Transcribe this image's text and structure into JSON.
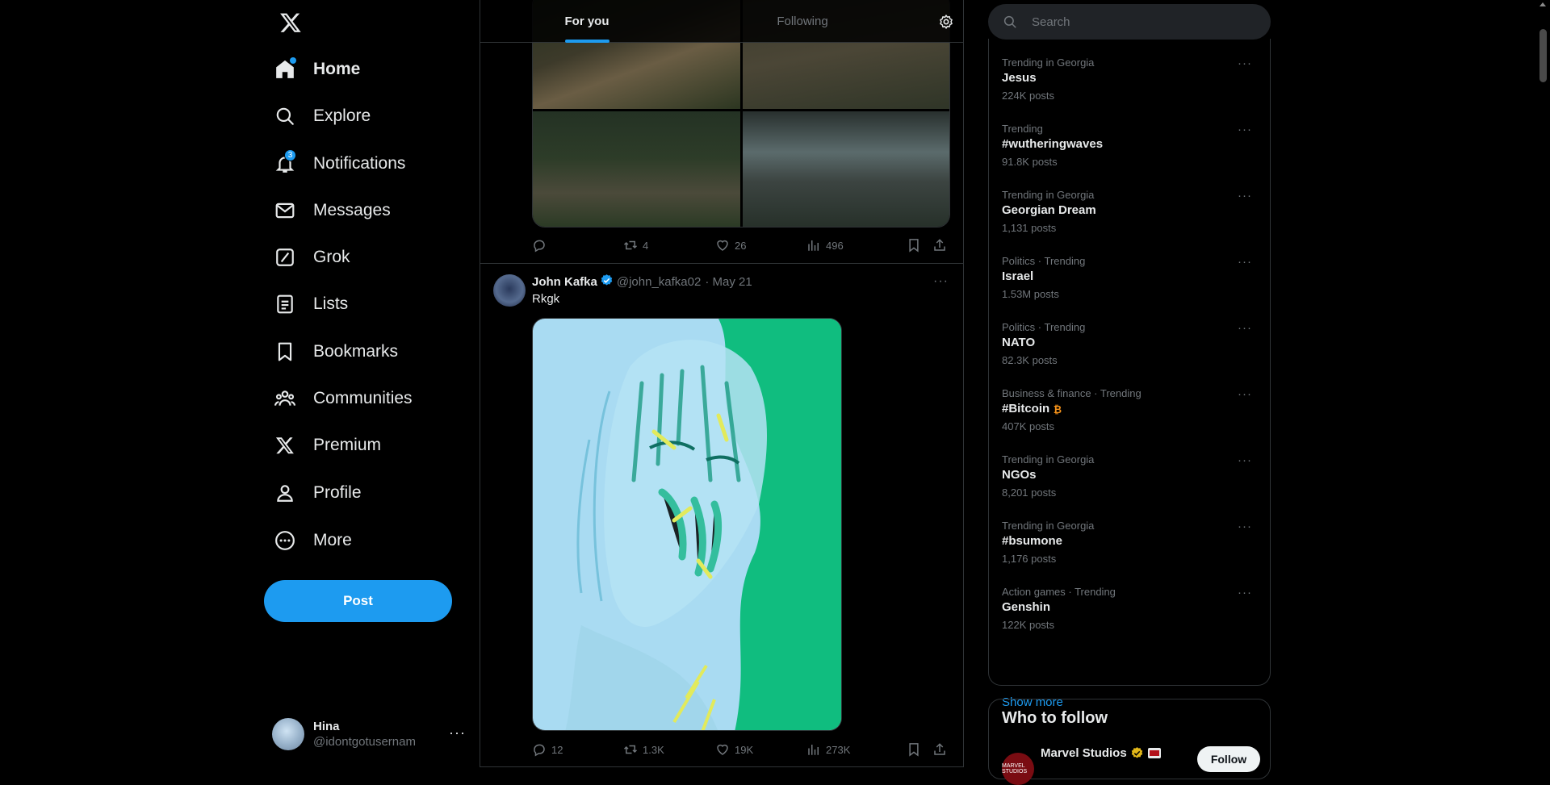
{
  "sidebar": {
    "items": [
      {
        "label": "Home",
        "icon": "home-icon"
      },
      {
        "label": "Explore",
        "icon": "search-icon"
      },
      {
        "label": "Notifications",
        "icon": "bell-icon",
        "badge": "3"
      },
      {
        "label": "Messages",
        "icon": "mail-icon"
      },
      {
        "label": "Grok",
        "icon": "grok-icon"
      },
      {
        "label": "Lists",
        "icon": "list-icon"
      },
      {
        "label": "Bookmarks",
        "icon": "bookmark-icon"
      },
      {
        "label": "Communities",
        "icon": "communities-icon"
      },
      {
        "label": "Premium",
        "icon": "x-logo-icon"
      },
      {
        "label": "Profile",
        "icon": "person-icon"
      },
      {
        "label": "More",
        "icon": "more-circle-icon"
      }
    ],
    "post_label": "Post",
    "account": {
      "name": "Hina",
      "handle": "@idontgotusernam"
    }
  },
  "timeline": {
    "tabs": [
      {
        "label": "For you"
      },
      {
        "label": "Following"
      }
    ],
    "tweet1": {
      "replies": "",
      "retweets": "4",
      "likes": "26",
      "views": "496"
    },
    "tweet2": {
      "name": "John Kafka",
      "handle": "@john_kafka02",
      "date": "· May 21",
      "text": "Rkgk",
      "replies": "12",
      "retweets": "1.3K",
      "likes": "19K",
      "views": "273K"
    }
  },
  "search": {
    "placeholder": "Search"
  },
  "trends": [
    {
      "context": "Trending in Georgia",
      "name": "Jesus",
      "count": "224K posts"
    },
    {
      "context": "Trending",
      "name": "#wutheringwaves",
      "count": "91.8K posts"
    },
    {
      "context": "Trending in Georgia",
      "name": "Georgian Dream",
      "count": "1,131 posts"
    },
    {
      "context": "Politics · Trending",
      "name": "Israel",
      "count": "1.53M posts"
    },
    {
      "context": "Politics · Trending",
      "name": "NATO",
      "count": "82.3K posts"
    },
    {
      "context": "Business & finance · Trending",
      "name": "#Bitcoin",
      "count": "407K posts"
    },
    {
      "context": "Trending in Georgia",
      "name": "NGOs",
      "count": "8,201 posts"
    },
    {
      "context": "Trending in Georgia",
      "name": "#bsumone",
      "count": "1,176 posts"
    },
    {
      "context": "Action games · Trending",
      "name": "Genshin",
      "count": "122K posts"
    }
  ],
  "show_more": "Show more",
  "who_to_follow": {
    "title": "Who to follow",
    "name": "Marvel Studios",
    "follow_label": "Follow",
    "avatar_text": "MARVEL STUDIOS"
  },
  "colors": {
    "accent": "#1d9bf0",
    "background": "#000000",
    "text": "#e7e9ea",
    "muted": "#71767b",
    "border": "#2f3336",
    "gold": "#e2b719"
  }
}
